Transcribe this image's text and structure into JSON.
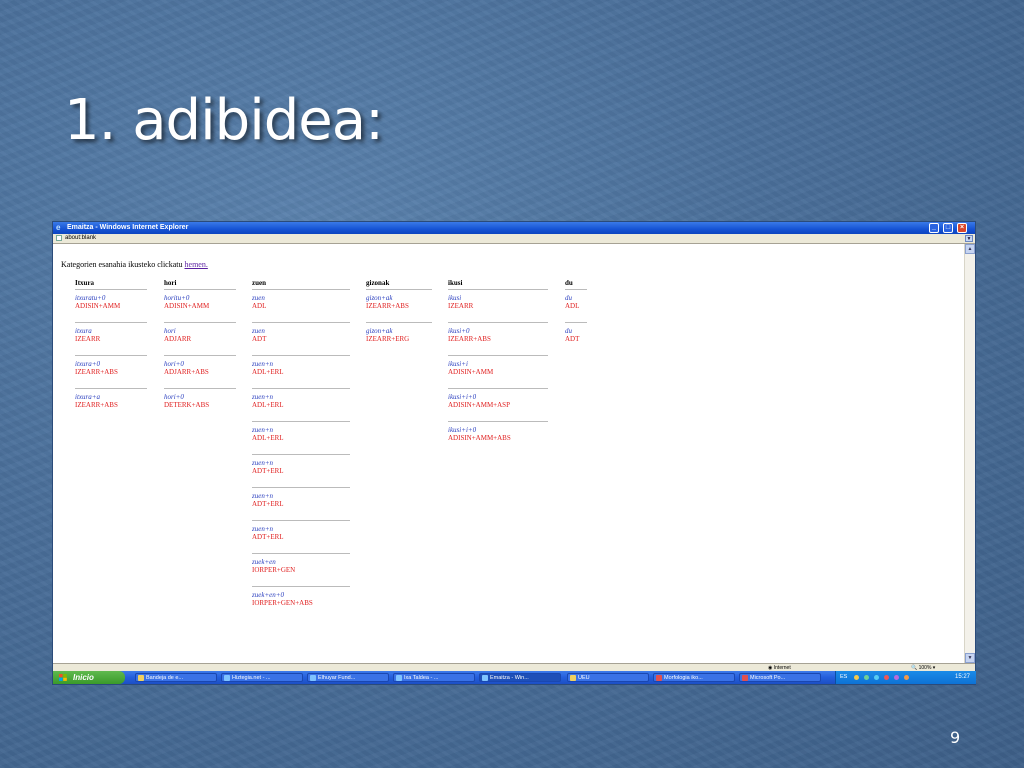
{
  "slide": {
    "title": "1. adibidea:",
    "number": "9"
  },
  "window": {
    "title": "Emaitza - Windows Internet Explorer",
    "address": "about:blank",
    "status_zone": "Internet",
    "zoom": "100%"
  },
  "page": {
    "intro": "Kategorien esanahia ikusteko clickatu ",
    "link": "hemen.",
    "columns": [
      {
        "header": "Itxura",
        "entries": [
          {
            "form": "itxuratu+0",
            "tag": "ADISIN+AMM"
          },
          {
            "form": "itxura",
            "tag": "IZEARR"
          },
          {
            "form": "itxura+0",
            "tag": "IZEARR+ABS"
          },
          {
            "form": "itxura+a",
            "tag": "IZEARR+ABS"
          }
        ]
      },
      {
        "header": "hori",
        "entries": [
          {
            "form": "horitu+0",
            "tag": "ADISIN+AMM"
          },
          {
            "form": "hori",
            "tag": "ADJARR"
          },
          {
            "form": "hori+0",
            "tag": "ADJARR+ABS"
          },
          {
            "form": "hori+0",
            "tag": "DETERK+ABS"
          }
        ]
      },
      {
        "header": "zuen",
        "entries": [
          {
            "form": "zuen",
            "tag": "ADL"
          },
          {
            "form": "zuen",
            "tag": "ADT"
          },
          {
            "form": "zuen+n",
            "tag": "ADL+ERL"
          },
          {
            "form": "zuen+n",
            "tag": "ADL+ERL"
          },
          {
            "form": "zuen+n",
            "tag": "ADL+ERL"
          },
          {
            "form": "zuen+n",
            "tag": "ADT+ERL"
          },
          {
            "form": "zuen+n",
            "tag": "ADT+ERL"
          },
          {
            "form": "zuen+n",
            "tag": "ADT+ERL"
          },
          {
            "form": "zuek+en",
            "tag": "IORPER+GEN"
          },
          {
            "form": "zuek+en+0",
            "tag": "IORPER+GEN+ABS"
          }
        ]
      },
      {
        "header": "gizonak",
        "entries": [
          {
            "form": "gizon+ak",
            "tag": "IZEARR+ABS"
          },
          {
            "form": "gizon+ak",
            "tag": "IZEARR+ERG"
          }
        ]
      },
      {
        "header": "ikusi",
        "entries": [
          {
            "form": "ikusi",
            "tag": "IZEARR"
          },
          {
            "form": "ikusi+0",
            "tag": "IZEARR+ABS"
          },
          {
            "form": "ikusi+i",
            "tag": "ADISIN+AMM"
          },
          {
            "form": "ikusi+i+0",
            "tag": "ADISIN+AMM+ASP"
          },
          {
            "form": "ikusi+i+0",
            "tag": "ADISIN+AMM+ABS"
          }
        ]
      },
      {
        "header": "du",
        "entries": [
          {
            "form": "du",
            "tag": "ADL"
          },
          {
            "form": "du",
            "tag": "ADT"
          }
        ]
      }
    ]
  },
  "taskbar": {
    "start": "Inicio",
    "tasks": [
      {
        "label": "Bandeja de e...",
        "color": "#f0d060"
      },
      {
        "label": "Hiztegia.net - ...",
        "color": "#7fc3ff"
      },
      {
        "label": "Elhuyar Fund...",
        "color": "#7fc3ff"
      },
      {
        "label": "Ixa Taldea - ...",
        "color": "#7fc3ff"
      },
      {
        "label": "Emaitza - Win...",
        "color": "#7fc3ff"
      },
      {
        "label": "UEU",
        "color": "#f0d060"
      },
      {
        "label": "Morfologia iko...",
        "color": "#e05050"
      },
      {
        "label": "Microsoft Po...",
        "color": "#e05050"
      }
    ],
    "lang": "ES",
    "clock": "15:27"
  },
  "colors": {
    "form": "#2b3fbf",
    "tag": "#e02020",
    "link": "#5a1fa0"
  }
}
